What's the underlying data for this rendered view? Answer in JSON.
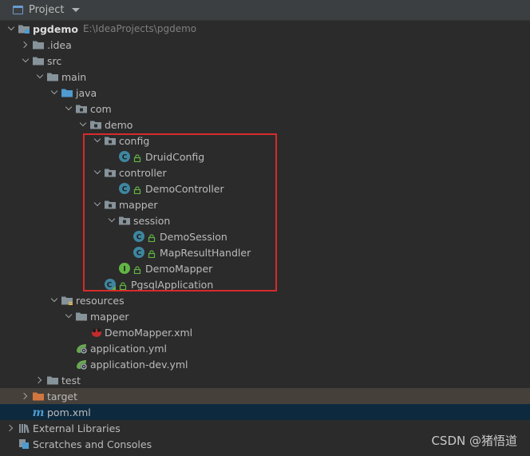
{
  "header": {
    "title": "Project",
    "icon": "project-panel-icon",
    "dropdown_icon": "chevron-down-icon"
  },
  "tree": [
    {
      "id": "pgdemo",
      "label": "pgdemo",
      "path": "E:\\IdeaProjects\\pgdemo",
      "depth": 0,
      "expanded": true,
      "icon": "module-folder",
      "bold": true
    },
    {
      "id": "idea",
      "label": ".idea",
      "depth": 1,
      "expanded": false,
      "icon": "folder"
    },
    {
      "id": "src",
      "label": "src",
      "depth": 1,
      "expanded": true,
      "icon": "folder"
    },
    {
      "id": "main",
      "label": "main",
      "depth": 2,
      "expanded": true,
      "icon": "folder"
    },
    {
      "id": "java",
      "label": "java",
      "depth": 3,
      "expanded": true,
      "icon": "source-folder"
    },
    {
      "id": "com",
      "label": "com",
      "depth": 4,
      "expanded": true,
      "icon": "package"
    },
    {
      "id": "demo",
      "label": "demo",
      "depth": 5,
      "expanded": true,
      "icon": "package"
    },
    {
      "id": "config",
      "label": "config",
      "depth": 6,
      "expanded": true,
      "icon": "package"
    },
    {
      "id": "DruidConfig",
      "label": "DruidConfig",
      "depth": 7,
      "icon": "class"
    },
    {
      "id": "controller",
      "label": "controller",
      "depth": 6,
      "expanded": true,
      "icon": "package"
    },
    {
      "id": "DemoController",
      "label": "DemoController",
      "depth": 7,
      "icon": "class"
    },
    {
      "id": "mapper",
      "label": "mapper",
      "depth": 6,
      "expanded": true,
      "icon": "package"
    },
    {
      "id": "session",
      "label": "session",
      "depth": 7,
      "expanded": true,
      "icon": "package"
    },
    {
      "id": "DemoSession",
      "label": "DemoSession",
      "depth": 8,
      "icon": "class"
    },
    {
      "id": "MapResultHandler",
      "label": "MapResultHandler",
      "depth": 8,
      "icon": "class"
    },
    {
      "id": "DemoMapper",
      "label": "DemoMapper",
      "depth": 7,
      "icon": "interface"
    },
    {
      "id": "PgsqlApplication",
      "label": "PgsqlApplication",
      "depth": 6,
      "icon": "spring-app-class"
    },
    {
      "id": "resources",
      "label": "resources",
      "depth": 3,
      "expanded": true,
      "icon": "resources-folder"
    },
    {
      "id": "mapper-res",
      "label": "mapper",
      "depth": 4,
      "expanded": true,
      "icon": "folder"
    },
    {
      "id": "DemoMapperXml",
      "label": "DemoMapper.xml",
      "depth": 5,
      "icon": "mybatis-xml"
    },
    {
      "id": "applicationYml",
      "label": "application.yml",
      "depth": 4,
      "icon": "spring-yml"
    },
    {
      "id": "applicationDevYml",
      "label": "application-dev.yml",
      "depth": 4,
      "icon": "spring-yml"
    },
    {
      "id": "test",
      "label": "test",
      "depth": 2,
      "expanded": false,
      "icon": "folder"
    },
    {
      "id": "target",
      "label": "target",
      "depth": 1,
      "expanded": false,
      "icon": "excluded-folder",
      "highlight": "target"
    },
    {
      "id": "pom",
      "label": "pom.xml",
      "depth": 1,
      "icon": "maven",
      "highlight": "pom"
    },
    {
      "id": "extlibs",
      "label": "External Libraries",
      "depth": 0,
      "expanded": false,
      "icon": "libraries"
    },
    {
      "id": "scratches",
      "label": "Scratches and Consoles",
      "depth": 0,
      "icon": "scratches"
    }
  ],
  "watermark": "CSDN @猪悟道",
  "colors": {
    "background": "#2b2b2b",
    "header": "#3c3f41",
    "folder": "#87939a",
    "source_folder": "#4f9bd0",
    "excluded_folder": "#d0763f",
    "class_icon": "#3e86a0",
    "interface_icon": "#62b543",
    "target_row": "#45403a",
    "selected_row": "#0d293e",
    "annotation_box": "#d72b2b"
  }
}
